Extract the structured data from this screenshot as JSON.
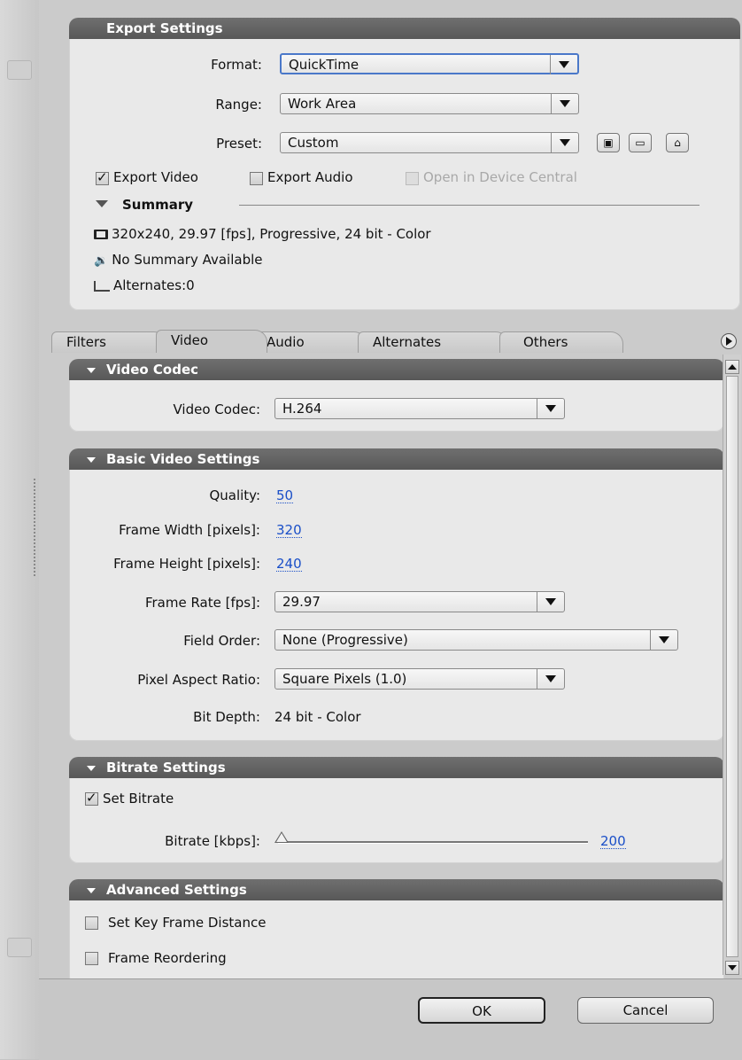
{
  "export_settings": {
    "title": "Export Settings",
    "format_label": "Format:",
    "format_value": "QuickTime",
    "range_label": "Range:",
    "range_value": "Work Area",
    "preset_label": "Preset:",
    "preset_value": "Custom",
    "export_video_label": "Export Video",
    "export_video_checked": true,
    "export_audio_label": "Export Audio",
    "export_audio_checked": false,
    "device_central_label": "Open in Device Central",
    "summary_label": "Summary",
    "summary_video": "320x240, 29.97 [fps], Progressive, 24 bit - Color",
    "summary_audio": "No Summary Available",
    "summary_alternates": "Alternates:0"
  },
  "tabs": [
    "Filters",
    "Video",
    "Audio",
    "Alternates",
    "Others"
  ],
  "active_tab": "Video",
  "video_codec": {
    "title": "Video Codec",
    "label": "Video Codec:",
    "value": "H.264"
  },
  "basic_video": {
    "title": "Basic Video Settings",
    "quality_label": "Quality:",
    "quality_value": "50",
    "width_label": "Frame Width [pixels]:",
    "width_value": "320",
    "height_label": "Frame Height [pixels]:",
    "height_value": "240",
    "frame_rate_label": "Frame Rate [fps]:",
    "frame_rate_value": "29.97",
    "field_order_label": "Field Order:",
    "field_order_value": "None (Progressive)",
    "par_label": "Pixel Aspect Ratio:",
    "par_value": "Square Pixels (1.0)",
    "bit_depth_label": "Bit Depth:",
    "bit_depth_value": "24 bit - Color"
  },
  "bitrate": {
    "title": "Bitrate Settings",
    "set_bitrate_label": "Set Bitrate",
    "set_bitrate_checked": true,
    "bitrate_label": "Bitrate [kbps]:",
    "bitrate_value": "200"
  },
  "advanced": {
    "title": "Advanced Settings",
    "key_frame_label": "Set Key Frame Distance",
    "frame_reordering_label": "Frame Reordering"
  },
  "footer": {
    "ok_label": "OK",
    "cancel_label": "Cancel"
  }
}
